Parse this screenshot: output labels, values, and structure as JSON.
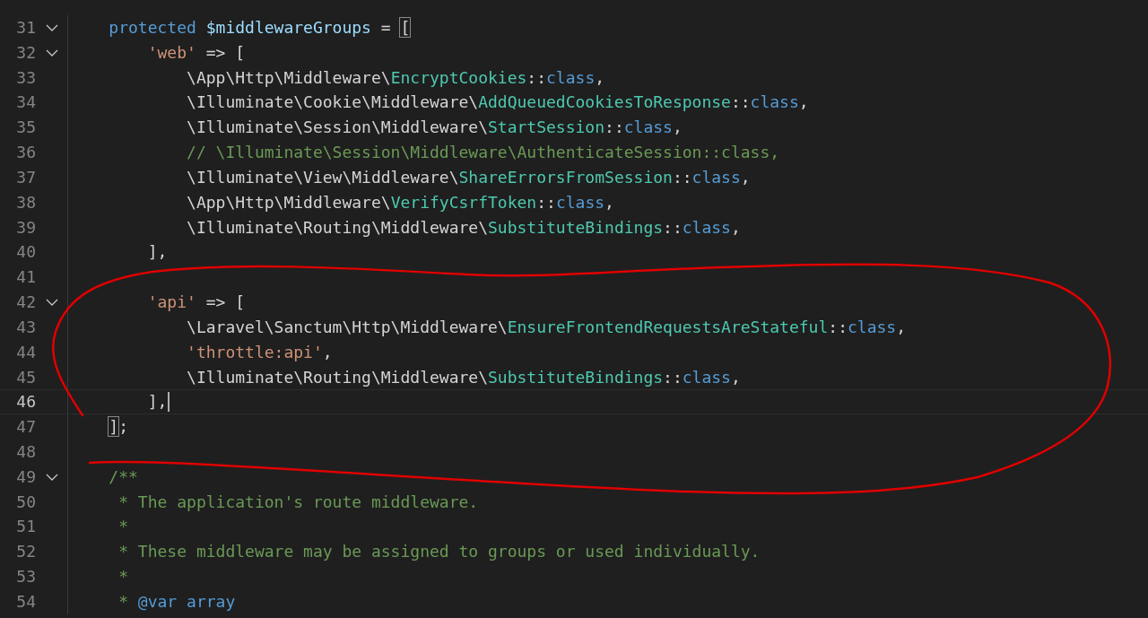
{
  "editor": {
    "lines": [
      {
        "number": "31",
        "foldable": true,
        "current": false,
        "tokens": [
          {
            "kind": "keyword",
            "text": "    protected "
          },
          {
            "kind": "variable",
            "text": "$middlewareGroups"
          },
          {
            "kind": "plain",
            "text": " = "
          },
          {
            "kind": "bracket-match",
            "text": "["
          }
        ]
      },
      {
        "number": "32",
        "foldable": true,
        "current": false,
        "tokens": [
          {
            "kind": "string",
            "text": "        'web'"
          },
          {
            "kind": "plain",
            "text": " => ["
          }
        ]
      },
      {
        "number": "33",
        "foldable": false,
        "current": false,
        "tokens": [
          {
            "kind": "plain",
            "text": "            \\App\\Http\\Middleware\\"
          },
          {
            "kind": "class",
            "text": "EncryptCookies"
          },
          {
            "kind": "plain",
            "text": "::"
          },
          {
            "kind": "keyword",
            "text": "class"
          },
          {
            "kind": "plain",
            "text": ","
          }
        ]
      },
      {
        "number": "34",
        "foldable": false,
        "current": false,
        "tokens": [
          {
            "kind": "plain",
            "text": "            \\Illuminate\\Cookie\\Middleware\\"
          },
          {
            "kind": "class",
            "text": "AddQueuedCookiesToResponse"
          },
          {
            "kind": "plain",
            "text": "::"
          },
          {
            "kind": "keyword",
            "text": "class"
          },
          {
            "kind": "plain",
            "text": ","
          }
        ]
      },
      {
        "number": "35",
        "foldable": false,
        "current": false,
        "tokens": [
          {
            "kind": "plain",
            "text": "            \\Illuminate\\Session\\Middleware\\"
          },
          {
            "kind": "class",
            "text": "StartSession"
          },
          {
            "kind": "plain",
            "text": "::"
          },
          {
            "kind": "keyword",
            "text": "class"
          },
          {
            "kind": "plain",
            "text": ","
          }
        ]
      },
      {
        "number": "36",
        "foldable": false,
        "current": false,
        "tokens": [
          {
            "kind": "comment",
            "text": "            // \\Illuminate\\Session\\Middleware\\AuthenticateSession::class,"
          }
        ]
      },
      {
        "number": "37",
        "foldable": false,
        "current": false,
        "tokens": [
          {
            "kind": "plain",
            "text": "            \\Illuminate\\View\\Middleware\\"
          },
          {
            "kind": "class",
            "text": "ShareErrorsFromSession"
          },
          {
            "kind": "plain",
            "text": "::"
          },
          {
            "kind": "keyword",
            "text": "class"
          },
          {
            "kind": "plain",
            "text": ","
          }
        ]
      },
      {
        "number": "38",
        "foldable": false,
        "current": false,
        "tokens": [
          {
            "kind": "plain",
            "text": "            \\App\\Http\\Middleware\\"
          },
          {
            "kind": "class",
            "text": "VerifyCsrfToken"
          },
          {
            "kind": "plain",
            "text": "::"
          },
          {
            "kind": "keyword",
            "text": "class"
          },
          {
            "kind": "plain",
            "text": ","
          }
        ]
      },
      {
        "number": "39",
        "foldable": false,
        "current": false,
        "tokens": [
          {
            "kind": "plain",
            "text": "            \\Illuminate\\Routing\\Middleware\\"
          },
          {
            "kind": "class",
            "text": "SubstituteBindings"
          },
          {
            "kind": "plain",
            "text": "::"
          },
          {
            "kind": "keyword",
            "text": "class"
          },
          {
            "kind": "plain",
            "text": ","
          }
        ]
      },
      {
        "number": "40",
        "foldable": false,
        "current": false,
        "tokens": [
          {
            "kind": "plain",
            "text": "        ],"
          }
        ]
      },
      {
        "number": "41",
        "foldable": false,
        "current": false
      },
      {
        "number": "42",
        "foldable": true,
        "current": false,
        "tokens": [
          {
            "kind": "string",
            "text": "        'api'"
          },
          {
            "kind": "plain",
            "text": " => ["
          }
        ]
      },
      {
        "number": "43",
        "foldable": false,
        "current": false,
        "tokens": [
          {
            "kind": "plain",
            "text": "            \\Laravel\\Sanctum\\Http\\Middleware\\"
          },
          {
            "kind": "class",
            "text": "EnsureFrontendRequestsAreStateful"
          },
          {
            "kind": "plain",
            "text": "::"
          },
          {
            "kind": "keyword",
            "text": "class"
          },
          {
            "kind": "plain",
            "text": ","
          }
        ]
      },
      {
        "number": "44",
        "foldable": false,
        "current": false,
        "tokens": [
          {
            "kind": "string",
            "text": "            'throttle:api'"
          },
          {
            "kind": "plain",
            "text": ","
          }
        ]
      },
      {
        "number": "45",
        "foldable": false,
        "current": false,
        "tokens": [
          {
            "kind": "plain",
            "text": "            \\Illuminate\\Routing\\Middleware\\"
          },
          {
            "kind": "class",
            "text": "SubstituteBindings"
          },
          {
            "kind": "plain",
            "text": "::"
          },
          {
            "kind": "keyword",
            "text": "class"
          },
          {
            "kind": "plain",
            "text": ","
          }
        ]
      },
      {
        "number": "46",
        "foldable": false,
        "current": true,
        "tokens": [
          {
            "kind": "plain",
            "text": "        ],"
          }
        ]
      },
      {
        "number": "47",
        "foldable": false,
        "current": false,
        "tokens": [
          {
            "kind": "bracket-match",
            "text": "    ]"
          },
          {
            "kind": "plain",
            "text": ";"
          }
        ]
      },
      {
        "number": "48",
        "foldable": false,
        "current": false
      },
      {
        "number": "49",
        "foldable": true,
        "current": false,
        "tokens": [
          {
            "kind": "comment",
            "text": "    /**"
          }
        ]
      },
      {
        "number": "50",
        "foldable": false,
        "current": false,
        "tokens": [
          {
            "kind": "comment",
            "text": "     * The application's route middleware."
          }
        ]
      },
      {
        "number": "51",
        "foldable": false,
        "current": false,
        "tokens": [
          {
            "kind": "comment",
            "text": "     *"
          }
        ]
      },
      {
        "number": "52",
        "foldable": false,
        "current": false,
        "tokens": [
          {
            "kind": "comment",
            "text": "     * These middleware may be assigned to groups or used individually."
          }
        ]
      },
      {
        "number": "53",
        "foldable": false,
        "current": false,
        "tokens": [
          {
            "kind": "comment",
            "text": "     *"
          }
        ]
      },
      {
        "number": "54",
        "foldable": false,
        "current": false,
        "tokens": [
          {
            "kind": "comment",
            "text": "     * "
          },
          {
            "kind": "doctag",
            "text": "@var array"
          }
        ]
      }
    ]
  }
}
